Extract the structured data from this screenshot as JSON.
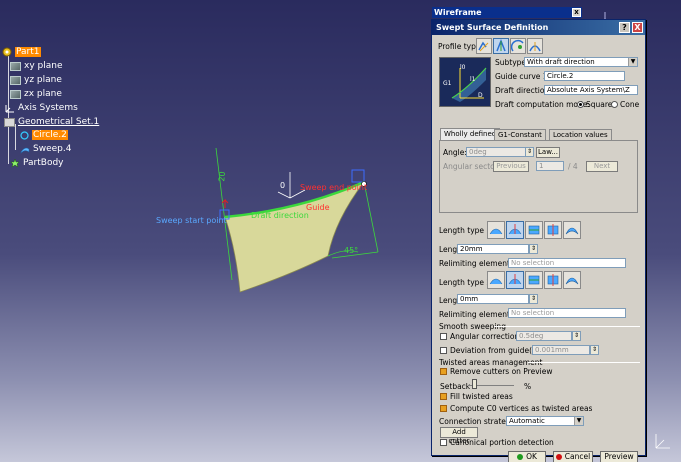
{
  "tree": {
    "part": "Part1",
    "xy_plane": "xy plane",
    "yz_plane": "yz plane",
    "zx_plane": "zx plane",
    "axis_systems": "Axis Systems",
    "geometrical_set": "Geometrical Set.1",
    "circle": "Circle.2",
    "sweep": "Sweep.4",
    "partbody": "PartBody"
  },
  "viewport": {
    "sweep_start": "Sweep start point",
    "sweep_end": "Sweep end point",
    "draft_direction": "Draft direction",
    "length_1": "20",
    "length_2": "0",
    "angle_label": "45°",
    "guide_label": "Guide"
  },
  "wireframe": {
    "title": "Wireframe",
    "close": "x"
  },
  "dialog": {
    "title": "Swept Surface Definition",
    "help": "?",
    "close": "X",
    "profile_type": "Profile type:",
    "preview_labels": {
      "g": "G1",
      "d": "D",
      "lo": "l0",
      "l1": "l1"
    },
    "subtype_label": "Subtype:",
    "subtype": "With draft direction",
    "guide_curve_label": "Guide curve 1:",
    "guide_curve": "Circle.2",
    "draft_direction_label": "Draft direction:",
    "draft_direction": "Absolute Axis System\\Z",
    "draft_computation_label": "Draft computation mode:",
    "square": "Square",
    "cone": "Cone",
    "tabs": [
      "Wholly defined",
      "G1-Constant",
      "Location values"
    ],
    "angle_label": "Angle:",
    "angle_value": "0deg",
    "law_button": "Law...",
    "angular_sector_label": "Angular sector:",
    "previous_button": "Previous",
    "sector_value": "1",
    "sector_total": "/ 4",
    "next_button": "Next",
    "length_type_1": "Length type 1:",
    "length_1_label": "Length 1:",
    "length_1_value": "20mm",
    "relimiting_1_label": "Relimiting element 1:",
    "relimiting_1_value": "No selection",
    "length_type_2": "Length type 2:",
    "length_2_label": "Length 2:",
    "length_2_value": "0mm",
    "relimiting_2_label": "Relimiting element 2:",
    "relimiting_2_value": "No selection",
    "smooth_sweeping": "Smooth sweeping",
    "angular_correction": "Angular correction:",
    "angular_correction_value": "0.5deg",
    "deviation": "Deviation from guide(s):",
    "deviation_value": "0.001mm",
    "twisted_areas": "Twisted areas management",
    "remove_cutters": "Remove cutters on Preview",
    "setback": "Setback",
    "setback_unit": "%",
    "fill_twisted": "Fill twisted areas",
    "compute_c0": "Compute C0 vertices as twisted areas",
    "connection_strategy_label": "Connection strategy:",
    "connection_strategy": "Automatic",
    "add_cutter": "Add cutter",
    "canonical": "Canonical portion detection",
    "ok": "OK",
    "cancel": "Cancel",
    "preview": "Preview"
  },
  "colors": {
    "selection": "#ff8a00",
    "surface": "#d8d89a",
    "guide": "#3cd83c",
    "ok_dot": "#1f9a1f",
    "cancel_dot": "#d01010"
  }
}
